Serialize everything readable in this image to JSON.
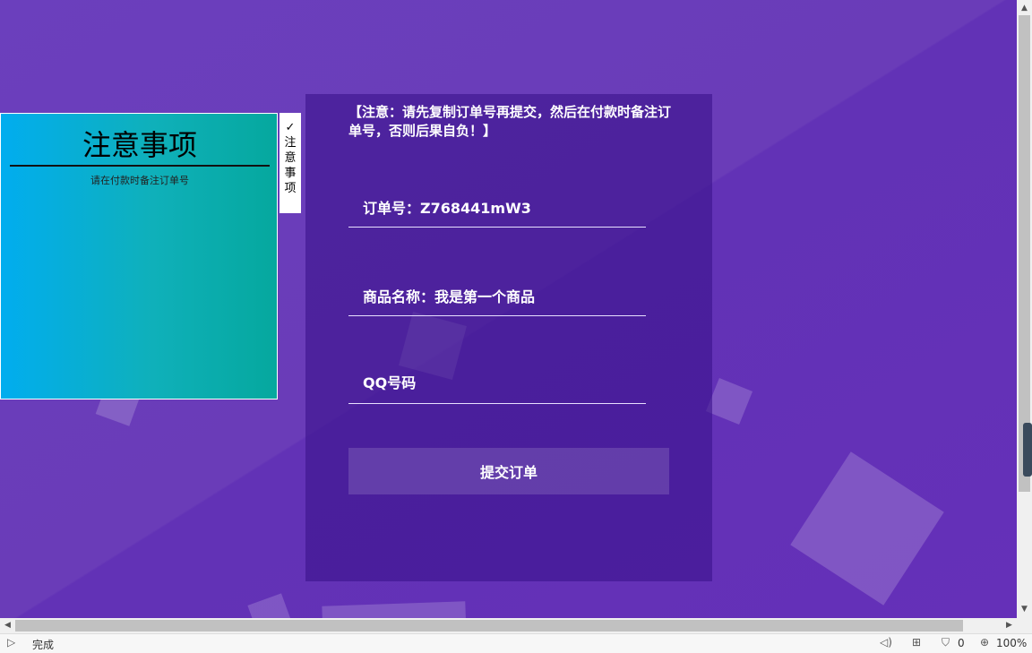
{
  "notice": {
    "title": "注意事项",
    "text": "请在付款时备注订单号",
    "tab_check": "✓",
    "tab_chars": [
      "注",
      "意",
      "事",
      "项"
    ]
  },
  "form": {
    "warning": "【注意：请先复制订单号再提交，然后在付款时备注订单号，否则后果自负！】",
    "order_field": "订单号：Z768441mW3",
    "product_field": "商品名称：我是第一个商品",
    "qq_placeholder": "QQ号码",
    "submit_label": "提交订单"
  },
  "statusbar": {
    "status": "完成",
    "blocked_count": "0",
    "zoom": "100%"
  },
  "icons": {
    "play": "play-icon",
    "sound": "speaker-icon",
    "download": "download-icon",
    "adblock": "shield-icon",
    "zoom": "zoom-in-icon"
  }
}
